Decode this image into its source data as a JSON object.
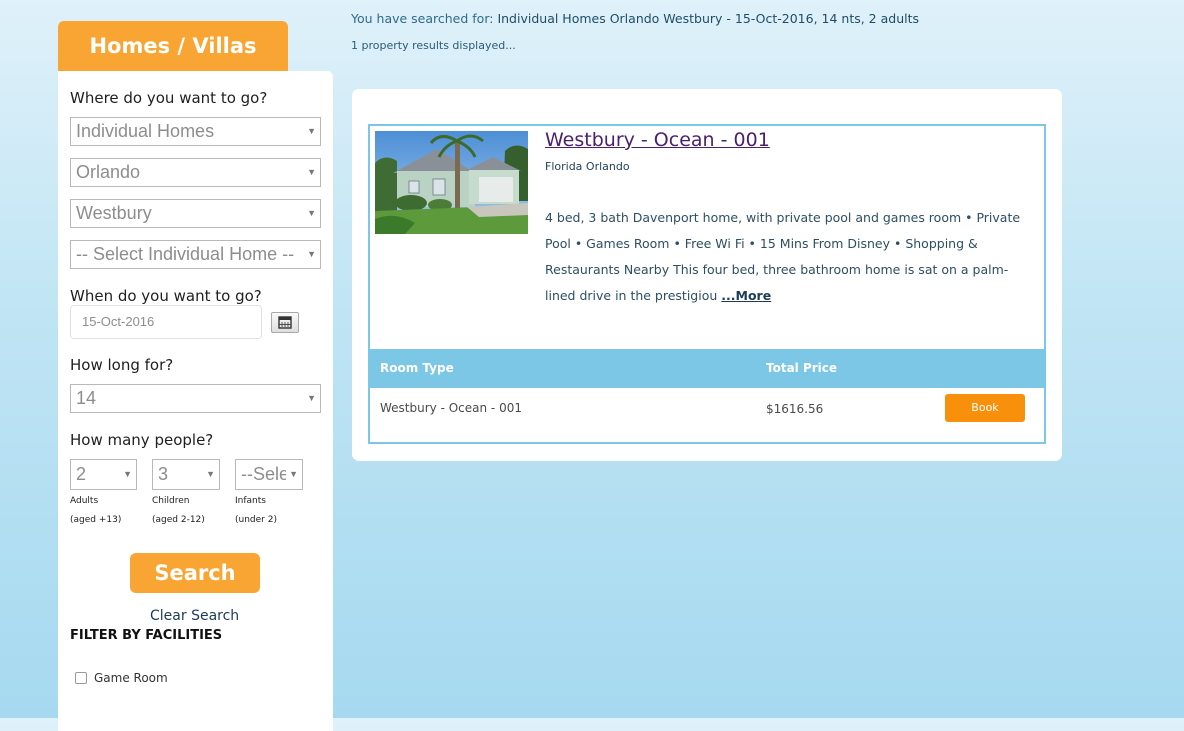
{
  "sidebar": {
    "tab_title": "Homes / Villas",
    "where_label": "Where do you want to go?",
    "category_select": "Individual Homes",
    "city_select": "Orlando",
    "area_select": "Westbury",
    "home_select": "-- Select Individual Home --",
    "when_label": "When do you want to go?",
    "date_value": "15-Oct-2016",
    "how_long_label": "How long for?",
    "nights_select": "14",
    "people_label": "How many people?",
    "adults_select": "2",
    "children_select": "3",
    "infants_select": "--Sele",
    "adults_label": "Adults",
    "adults_sub": "(aged +13)",
    "children_label": "Children",
    "children_sub": "(aged 2-12)",
    "infants_label": "Infants",
    "infants_sub": "(under 2)",
    "search_button": "Search",
    "clear_search": "Clear Search",
    "filter_title": "FILTER BY FACILITIES",
    "filter_game_room": "Game Room"
  },
  "summary": {
    "prefix": "You have searched for:",
    "query": "Individual Homes Orlando Westbury - 15-Oct-2016, 14 nts, 2 adults",
    "count": "1 property results displayed..."
  },
  "property": {
    "title": "Westbury - Ocean - 001",
    "location": "Florida Orlando",
    "description": "4 bed, 3 bath Davenport home, with private pool and games room • Private Pool • Games Room • Free Wi Fi • 15 Mins From Disney • Shopping & Restaurants Nearby This four bed, three bathroom home is sat on a palm-lined drive in the prestigiou",
    "more_link": "...More",
    "room_type_header": "Room Type",
    "total_price_header": "Total Price",
    "room_name": "Westbury - Ocean - 001",
    "room_price": "$1616.56",
    "book_button": "Book"
  },
  "colors": {
    "accent_orange": "#f9a533",
    "book_orange": "#f8900c",
    "table_header_blue": "#7cc6e6"
  }
}
